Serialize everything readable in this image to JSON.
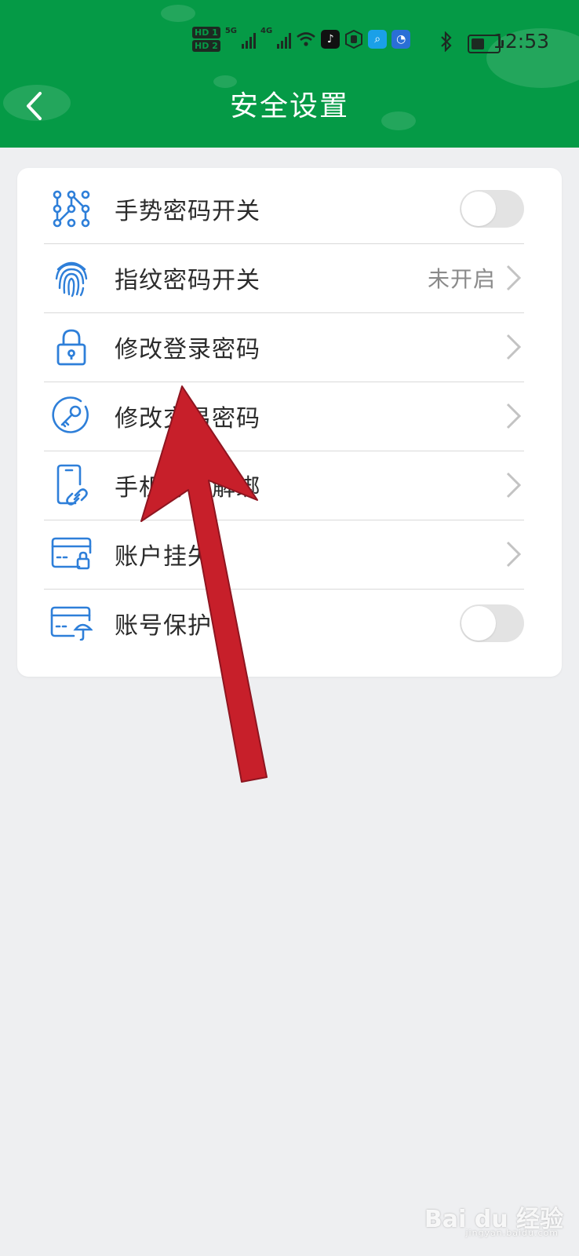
{
  "status_bar": {
    "hd1": "HD 1",
    "hd2": "HD 2",
    "net1": "5G",
    "net2": "4G",
    "time": "12:53",
    "icons": [
      "signal-icon",
      "signal-icon",
      "wifi-icon",
      "tiktok-icon",
      "hand-icon",
      "search-app-icon",
      "bulb-app-icon",
      "bluetooth-icon",
      "battery-icon"
    ]
  },
  "header": {
    "title": "安全设置",
    "background_color": "#059a46"
  },
  "settings": {
    "items": [
      {
        "label": "手势密码开关",
        "icon": "gesture-pattern-icon",
        "control": "toggle",
        "on": false
      },
      {
        "label": "指纹密码开关",
        "icon": "fingerprint-icon",
        "control": "chevron",
        "value": "未开启"
      },
      {
        "label": "修改登录密码",
        "icon": "lock-icon",
        "control": "chevron"
      },
      {
        "label": "修改交易密码",
        "icon": "key-icon",
        "control": "chevron"
      },
      {
        "label": "手机号码解绑",
        "icon": "phone-link-icon",
        "control": "chevron"
      },
      {
        "label": "账户挂失",
        "icon": "card-lock-icon",
        "control": "chevron"
      },
      {
        "label": "账号保护",
        "icon": "card-umbrella-icon",
        "control": "toggle",
        "on": false
      }
    ]
  },
  "annotation": {
    "arrow_color": "#c71f2a"
  },
  "watermark": {
    "text": "Bai du 经验",
    "sub": "jingyan.baidu.com"
  },
  "colors": {
    "icon_blue": "#2e7fd9",
    "accent_green": "#059a46",
    "page_bg": "#eeeff1"
  }
}
